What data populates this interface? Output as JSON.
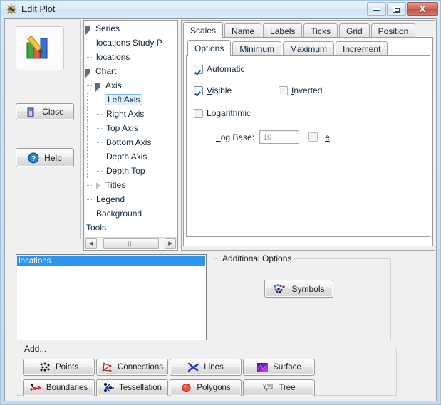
{
  "window": {
    "title": "Edit Plot",
    "title_icon": "sun-plot-icon",
    "caption_buttons": [
      {
        "name": "minimize-button",
        "glyph": "minimize-icon",
        "label": ""
      },
      {
        "name": "maximize-button",
        "glyph": "maximize-icon",
        "label": ""
      },
      {
        "name": "close-window-button",
        "glyph": "close-x-icon",
        "label": "X"
      }
    ],
    "accent_border": "#9ec4e2",
    "close_button_color": "#c0503f"
  },
  "left_panel": {
    "plot_icon": "bar-chart-with-brush-icon",
    "close_button": {
      "label": "Close",
      "icon": "exit-door-icon"
    },
    "help_button": {
      "label": "Help",
      "icon": "question-mark-icon"
    }
  },
  "tree": {
    "nodes": [
      {
        "label": "Series",
        "depth": 0,
        "twisty": "open",
        "selected": false
      },
      {
        "label": "locations Study P",
        "depth": 1,
        "twisty": "none",
        "selected": false
      },
      {
        "label": "locations",
        "depth": 1,
        "twisty": "none",
        "selected": false
      },
      {
        "label": "Chart",
        "depth": 0,
        "twisty": "open",
        "selected": false
      },
      {
        "label": "Axis",
        "depth": 1,
        "twisty": "open",
        "selected": false
      },
      {
        "label": "Left Axis",
        "depth": 2,
        "twisty": "none",
        "selected": true
      },
      {
        "label": "Right Axis",
        "depth": 2,
        "twisty": "none",
        "selected": false
      },
      {
        "label": "Top Axis",
        "depth": 2,
        "twisty": "none",
        "selected": false
      },
      {
        "label": "Bottom Axis",
        "depth": 2,
        "twisty": "none",
        "selected": false
      },
      {
        "label": "Depth Axis",
        "depth": 2,
        "twisty": "none",
        "selected": false
      },
      {
        "label": "Depth Top",
        "depth": 2,
        "twisty": "none",
        "selected": false
      },
      {
        "label": "Titles",
        "depth": 1,
        "twisty": "closed",
        "selected": false
      },
      {
        "label": "Legend",
        "depth": 1,
        "twisty": "none",
        "selected": false
      },
      {
        "label": "Background",
        "depth": 1,
        "twisty": "none",
        "selected": false
      },
      {
        "label": "Tools",
        "depth": 0,
        "twisty": "none",
        "selected": false
      }
    ],
    "scrollbar": {
      "left_arrow": "chevron-left-icon",
      "right_arrow": "chevron-right-icon",
      "thumb_grip": "⦙⦙⦙"
    }
  },
  "tabs_outer": {
    "items": [
      {
        "label": "Scales",
        "active": true
      },
      {
        "label": "Name",
        "active": false
      },
      {
        "label": "Labels",
        "active": false
      },
      {
        "label": "Ticks",
        "active": false
      },
      {
        "label": "Grid",
        "active": false
      },
      {
        "label": "Position",
        "active": false
      }
    ]
  },
  "tabs_inner": {
    "items": [
      {
        "label": "Options",
        "active": true
      },
      {
        "label": "Minimum",
        "active": false
      },
      {
        "label": "Maximum",
        "active": false
      },
      {
        "label": "Increment",
        "active": false
      }
    ]
  },
  "scales_options": {
    "automatic": {
      "label": "Automatic",
      "checked": true,
      "enabled": true
    },
    "visible": {
      "label": "Visible",
      "checked": true,
      "enabled": true
    },
    "inverted": {
      "label": "Inverted",
      "checked": false,
      "enabled": true
    },
    "logarithmic": {
      "label": "Logarithmic",
      "checked": false,
      "enabled": true
    },
    "log_base": {
      "label": "Log Base:",
      "value": "",
      "placeholder": "10"
    },
    "e_checkbox": {
      "label": "e",
      "checked": false,
      "enabled": false
    }
  },
  "series_list": {
    "items": [
      {
        "label": "locations",
        "selected": true
      }
    ],
    "selection_color": "#2e95ee"
  },
  "additional_options": {
    "caption": "Additional Options",
    "symbols_button": {
      "label": "Symbols",
      "icon": "scatter-symbols-icon"
    }
  },
  "add_section": {
    "caption": "Add...",
    "buttons": [
      {
        "label": "Points",
        "icon": "points-scatter-icon",
        "col": 0,
        "row": 0
      },
      {
        "label": "Connections",
        "icon": "connections-graph-icon",
        "col": 1,
        "row": 0
      },
      {
        "label": "Lines",
        "icon": "polyline-icon",
        "col": 2,
        "row": 0
      },
      {
        "label": "Surface",
        "icon": "surface-texture-icon",
        "col": 3,
        "row": 0
      },
      {
        "label": "Boundaries",
        "icon": "boundary-path-icon",
        "col": 0,
        "row": 1
      },
      {
        "label": "Tessellation",
        "icon": "tessellation-icon",
        "col": 1,
        "row": 1
      },
      {
        "label": "Polygons",
        "icon": "filled-polygon-icon",
        "col": 2,
        "row": 1
      },
      {
        "label": "Tree",
        "icon": "tree-diagram-icon",
        "col": 3,
        "row": 1
      }
    ]
  }
}
